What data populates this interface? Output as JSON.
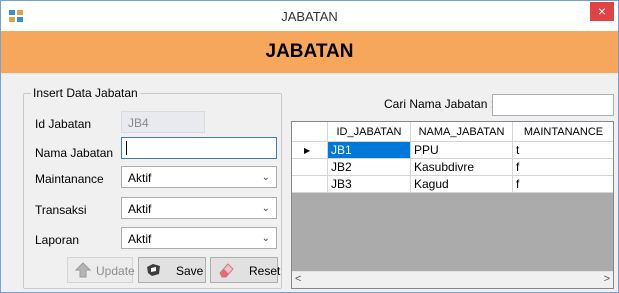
{
  "window": {
    "title": "JABATAN",
    "close_glyph": "×",
    "icon": "app-icon"
  },
  "header": {
    "title": "JABATAN"
  },
  "form": {
    "group_title": "Insert Data Jabatan",
    "id_label": "Id Jabatan",
    "id_value": "JB4",
    "nama_label": "Nama Jabatan",
    "nama_value": "",
    "maintanance_label": "Maintanance",
    "maintanance_value": "Aktif",
    "transaksi_label": "Transaksi",
    "transaksi_value": "Aktif",
    "laporan_label": "Laporan",
    "laporan_value": "Aktif",
    "combo_arrow": "⌄"
  },
  "buttons": {
    "update": "Update",
    "save": "Save",
    "reset": "Reset"
  },
  "search": {
    "label": "Cari Nama Jabatan :",
    "value": ""
  },
  "grid": {
    "columns": [
      "ID_JABATAN",
      "NAMA_JABATAN",
      "MAINTANANCE"
    ],
    "rows": [
      [
        "JB1",
        "PPU",
        "t"
      ],
      [
        "JB2",
        "Kasubdivre",
        "f"
      ],
      [
        "JB3",
        "Kagud",
        "f"
      ]
    ],
    "current_row_marker": "▶",
    "scroll_left": "<",
    "scroll_right": ">"
  },
  "colors": {
    "header_bg": "#f7a75b",
    "selection": "#0078d7",
    "close_button": "#e04343"
  }
}
